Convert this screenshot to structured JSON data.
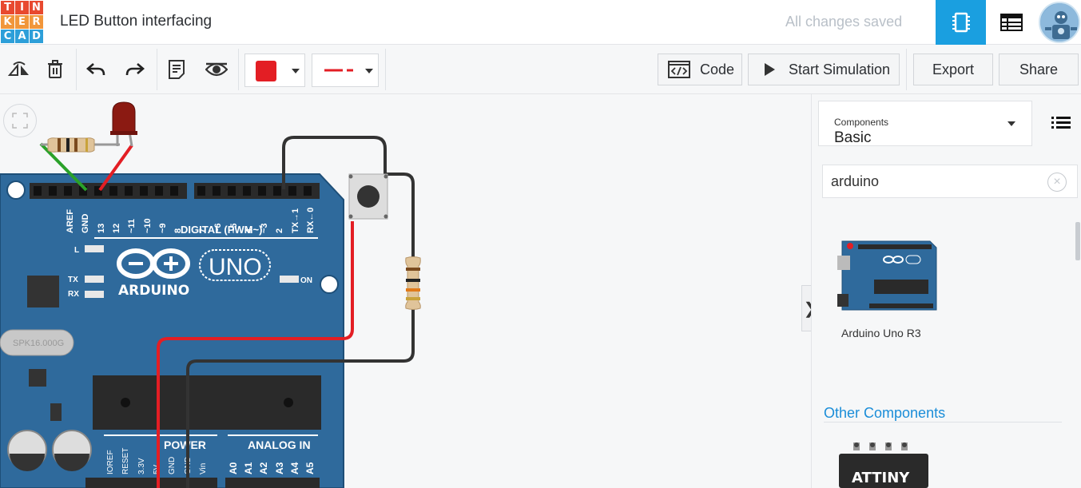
{
  "header": {
    "logo_letters": [
      "T",
      "I",
      "N",
      "K",
      "E",
      "R",
      "C",
      "A",
      "D"
    ],
    "logo_colors": [
      "#e8492f",
      "#e8492f",
      "#e8492f",
      "#f1963b",
      "#f1963b",
      "#f1963b",
      "#2d9fd9",
      "#2d9fd9",
      "#2d9fd9"
    ],
    "title": "LED Button interfacing",
    "save_status": "All changes saved",
    "circuit_view_icon": "circuit-chip-icon",
    "schematic_view_icon": "table-list-icon",
    "accent_color": "#1a9fe0"
  },
  "toolbar": {
    "rotate_icon": "rotate-icon",
    "delete_icon": "trash-icon",
    "undo_icon": "undo-icon",
    "redo_icon": "redo-icon",
    "notes_icon": "notes-icon",
    "visibility_icon": "eye-icon",
    "wire_color": "#e31e24",
    "code_label": "Code",
    "simulate_label": "Start Simulation",
    "export_label": "Export",
    "share_label": "Share"
  },
  "canvas": {
    "board_name": "ARDUINO",
    "board_model": "UNO",
    "digital_label": "DIGITAL (PWM~)",
    "power_label": "POWER",
    "analog_label": "ANALOG IN",
    "on_label": "ON",
    "l_label": "L",
    "tx_label": "TX",
    "rx_label": "RX",
    "crystal_label": "SPK16.000G",
    "top_pins": [
      "AREF",
      "GND",
      "13",
      "12",
      "~11",
      "~10",
      "~9",
      "8",
      "7",
      "~6",
      "~5",
      "4",
      "~3",
      "2",
      "TX→1",
      "RX←0"
    ],
    "bottom_pins": [
      "IOREF",
      "RESET",
      "3.3V",
      "5V",
      "GND",
      "GND",
      "Vin",
      "A0",
      "A1",
      "A2",
      "A3",
      "A4",
      "A5"
    ]
  },
  "panel": {
    "components_label": "Components",
    "components_value": "Basic",
    "search_value": "arduino",
    "result_label": "Arduino Uno R3",
    "other_title": "Other Components",
    "attiny_label": "ATTINY"
  }
}
